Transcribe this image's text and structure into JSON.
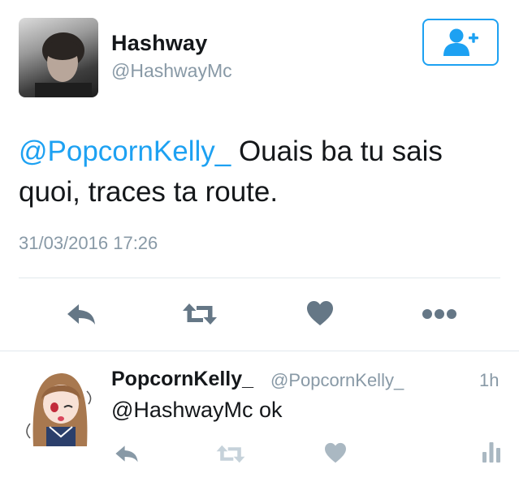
{
  "tweet": {
    "author_name": "Hashway",
    "author_handle": "@HashwayMc",
    "mention": "@PopcornKelly_",
    "text_line1": " Ouais ba tu sais",
    "text_line2": "quoi, traces ta route.",
    "timestamp": "31/03/2016 17:26",
    "follow_icon": "add-user-icon"
  },
  "actions": [
    "reply-icon",
    "retweet-icon",
    "like-icon",
    "more-icon"
  ],
  "reply": {
    "author_name": "PopcornKelly_",
    "author_handle": "@PopcornKelly_",
    "time": "1h",
    "text": "@HashwayMc ok",
    "actions": [
      "reply-icon",
      "retweet-icon",
      "like-icon",
      "analytics-icon"
    ]
  },
  "colors": {
    "accent": "#1da1f2",
    "muted": "#8899a6",
    "icon_dark": "#657786",
    "icon_light": "#aab8c2"
  }
}
